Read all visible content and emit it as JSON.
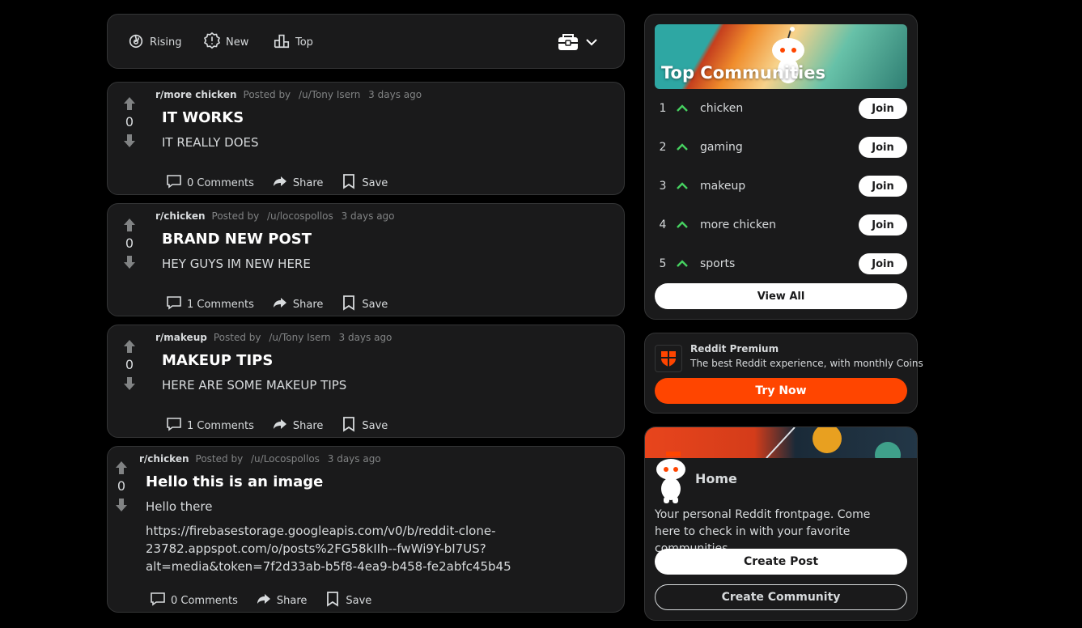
{
  "sort": {
    "rising": "Rising",
    "new": "New",
    "top": "Top"
  },
  "posts": [
    {
      "subreddit": "r/more chicken",
      "posted_by": "Posted by",
      "user": "/u/Tony Isern",
      "time": "3 days ago",
      "votes": "0",
      "title": "IT WORKS",
      "body": "IT REALLY DOES",
      "comments": "0 Comments",
      "share": "Share",
      "save": "Save"
    },
    {
      "subreddit": "r/chicken",
      "posted_by": "Posted by",
      "user": "/u/locospollos",
      "time": "3 days ago",
      "votes": "0",
      "title": "BRAND NEW POST",
      "body": "HEY GUYS IM NEW HERE",
      "comments": "1 Comments",
      "share": "Share",
      "save": "Save"
    },
    {
      "subreddit": "r/makeup",
      "posted_by": "Posted by",
      "user": "/u/Tony Isern",
      "time": "3 days ago",
      "votes": "0",
      "title": "MAKEUP TIPS",
      "body": "HERE ARE SOME MAKEUP TIPS",
      "comments": "1 Comments",
      "share": "Share",
      "save": "Save"
    },
    {
      "subreddit": "r/chicken",
      "posted_by": "Posted by",
      "user": "/u/Locospollos",
      "time": "3 days ago",
      "votes": "0",
      "title": "Hello this is an image",
      "body": "Hello there",
      "url_line1": "https://firebasestorage.googleapis.com/v0/b/reddit-clone-",
      "url_line2": "23782.appspot.com/o/posts%2FG58kIIh--fwWi9Y-bI7US?",
      "url_line3": "alt=media&token=7f2d33ab-b5f8-4ea9-b458-fe2abfc45b45",
      "comments": "0 Comments",
      "share": "Share",
      "save": "Save"
    }
  ],
  "top_communities": {
    "title": "Top Communities",
    "items": [
      {
        "rank": "1",
        "name": "chicken",
        "join": "Join"
      },
      {
        "rank": "2",
        "name": "gaming",
        "join": "Join"
      },
      {
        "rank": "3",
        "name": "makeup",
        "join": "Join"
      },
      {
        "rank": "4",
        "name": "more chicken",
        "join": "Join"
      },
      {
        "rank": "5",
        "name": "sports",
        "join": "Join"
      }
    ],
    "view_all": "View All"
  },
  "premium": {
    "title": "Reddit Premium",
    "desc": "The best Reddit experience, with monthly Coins",
    "button": "Try Now"
  },
  "home": {
    "title": "Home",
    "desc": "Your personal Reddit frontpage. Come here to check in with your favorite communities.",
    "create_post": "Create Post",
    "create_community": "Create Community"
  },
  "colors": {
    "accent": "#ff4500",
    "upvote_green": "#46d160",
    "card_bg": "#1a1a1b"
  },
  "icons": [
    "rising-icon",
    "new-icon",
    "top-icon",
    "layout-card-icon",
    "chevron-down-icon",
    "upvote-icon",
    "downvote-icon",
    "comment-icon",
    "share-icon",
    "save-icon",
    "trending-up-icon",
    "premium-shield-icon",
    "snoo-icon"
  ]
}
